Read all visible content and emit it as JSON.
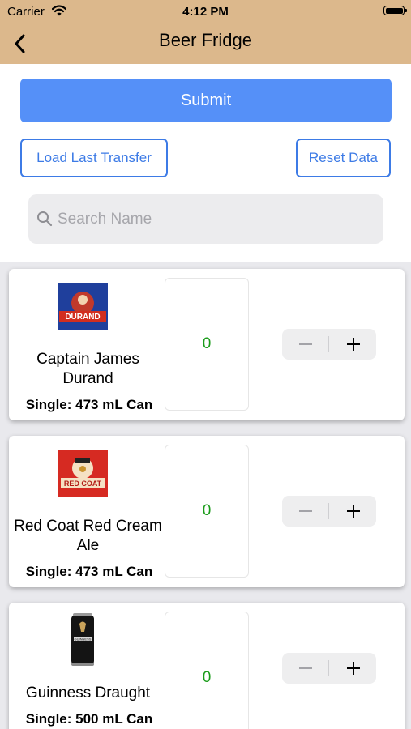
{
  "status_bar": {
    "carrier": "Carrier",
    "time": "4:12 PM"
  },
  "nav": {
    "title": "Beer Fridge"
  },
  "actions": {
    "submit_label": "Submit",
    "load_label": "Load Last Transfer",
    "reset_label": "Reset Data"
  },
  "search": {
    "placeholder": "Search Name",
    "value": ""
  },
  "products": [
    {
      "name": "Captain James Durand",
      "size": "Single: 473 mL Can",
      "quantity": "0",
      "image_text": "DURAND"
    },
    {
      "name": "Red Coat Red Cream Ale",
      "size": "Single: 473 mL Can",
      "quantity": "0",
      "image_text": "RED COAT"
    },
    {
      "name": "Guinness Draught",
      "size": "Single: 500 mL Can",
      "quantity": "0",
      "image_text": "GUINNESS"
    }
  ],
  "colors": {
    "nav_bg": "#dcb88c",
    "accent": "#5590f8",
    "quantity_text": "#1a9c1a"
  },
  "icons": {
    "back": "chevron-left-icon",
    "search": "search-icon",
    "minus": "minus-icon",
    "plus": "plus-icon",
    "wifi": "wifi-icon",
    "battery": "battery-icon"
  }
}
